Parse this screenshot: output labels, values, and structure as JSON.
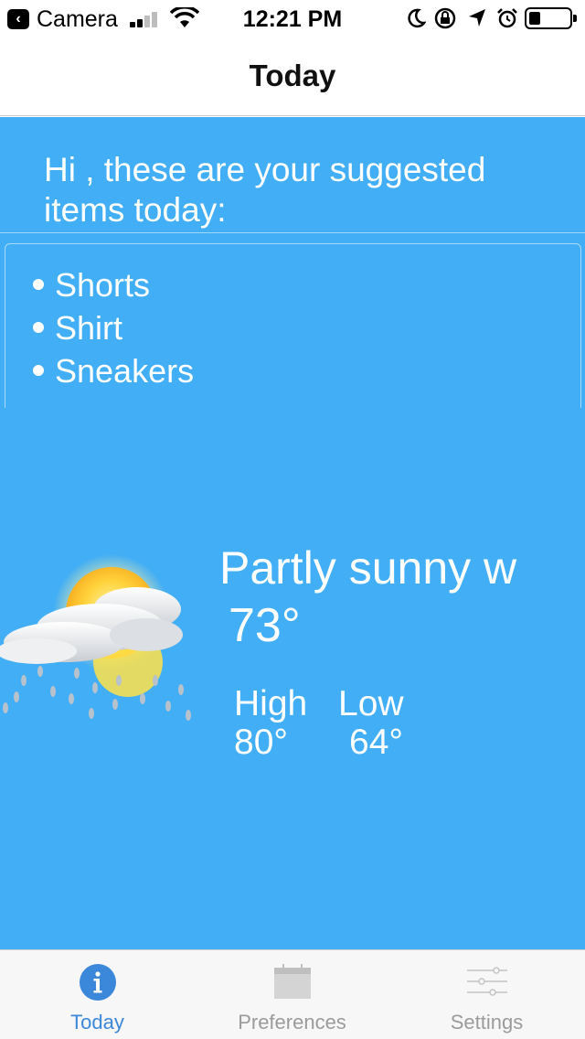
{
  "status_bar": {
    "back_app": "Camera",
    "time": "12:21 PM"
  },
  "nav": {
    "title": "Today"
  },
  "main": {
    "greeting": "Hi , these are your suggested items today:",
    "items": [
      "Shorts",
      "Shirt",
      "Sneakers"
    ],
    "weather": {
      "icon": "partly-sunny-rain-icon",
      "condition": "Partly sunny w",
      "temperature": "73°",
      "high_label": "High",
      "high_value": "80°",
      "low_label": "Low",
      "low_value": "64°"
    }
  },
  "tabs": [
    {
      "label": "Today",
      "icon": "info-icon",
      "active": true
    },
    {
      "label": "Preferences",
      "icon": "calendar-icon",
      "active": false
    },
    {
      "label": "Settings",
      "icon": "sliders-icon",
      "active": false
    }
  ],
  "colors": {
    "background": "#42aef5",
    "tab_active": "#3b87d9",
    "tab_inactive": "#9b9b9b"
  }
}
